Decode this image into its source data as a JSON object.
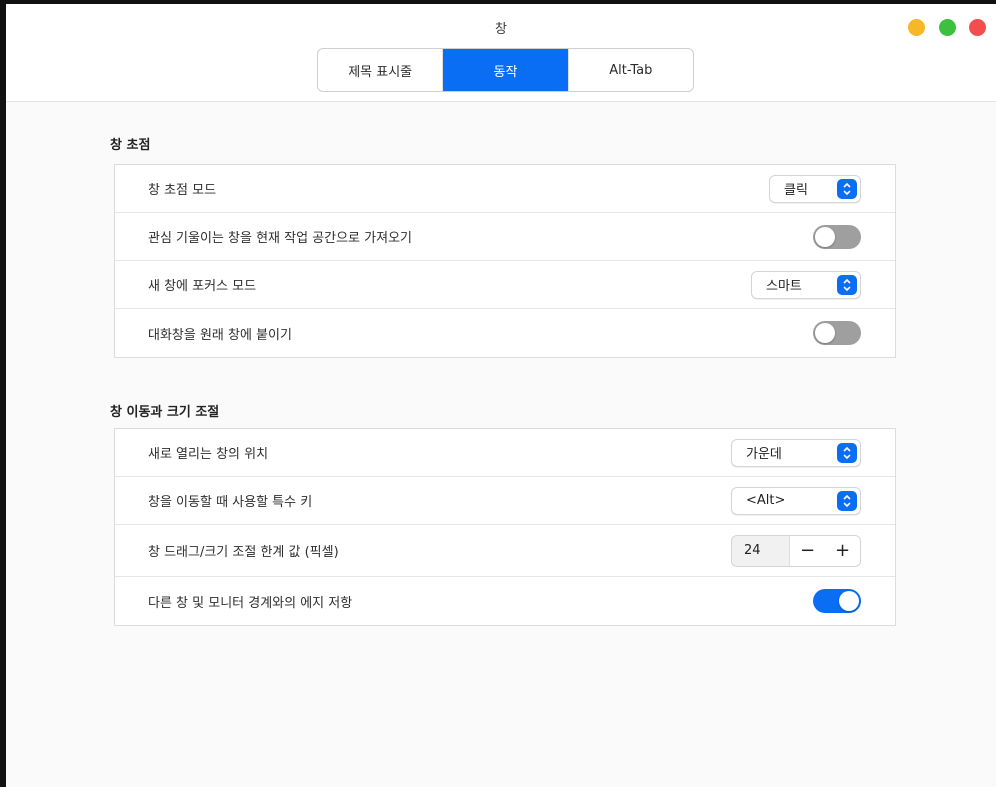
{
  "window": {
    "title": "창"
  },
  "tabs": [
    {
      "label": "제목 표시줄",
      "active": false
    },
    {
      "label": "동작",
      "active": true
    },
    {
      "label": "Alt-Tab",
      "active": false
    }
  ],
  "focus_section": {
    "title": "창 초점",
    "rows": [
      {
        "label": "창 초점 모드",
        "control": "dropdown",
        "value": "클릭"
      },
      {
        "label": "관심 기울이는 창을 현재 작업 공간으로 가져오기",
        "control": "toggle",
        "on": false
      },
      {
        "label": "새 창에 포커스 모드",
        "control": "dropdown",
        "value": "스마트"
      },
      {
        "label": "대화창을 원래 창에 붙이기",
        "control": "toggle",
        "on": false
      }
    ]
  },
  "move_section": {
    "title": "창 이동과 크기 조절",
    "rows": [
      {
        "label": "새로 열리는 창의 위치",
        "control": "dropdown",
        "value": "가운데"
      },
      {
        "label": "창을 이동할 때 사용할 특수 키",
        "control": "dropdown",
        "value": "<Alt>"
      },
      {
        "label": "창 드래그/크기 조절 한계 값 (픽셀)",
        "control": "spin",
        "value": "24",
        "minus": "−",
        "plus": "+"
      },
      {
        "label": "다른 창 및 모니터 경계와의 에지 저항",
        "control": "toggle",
        "on": true
      }
    ]
  },
  "colors": {
    "accent": "#0a6ef4",
    "toggle_off": "#9f9f9f",
    "traffic_yellow": "#f6b827",
    "traffic_green": "#3dc040",
    "traffic_red": "#f44d4d"
  }
}
